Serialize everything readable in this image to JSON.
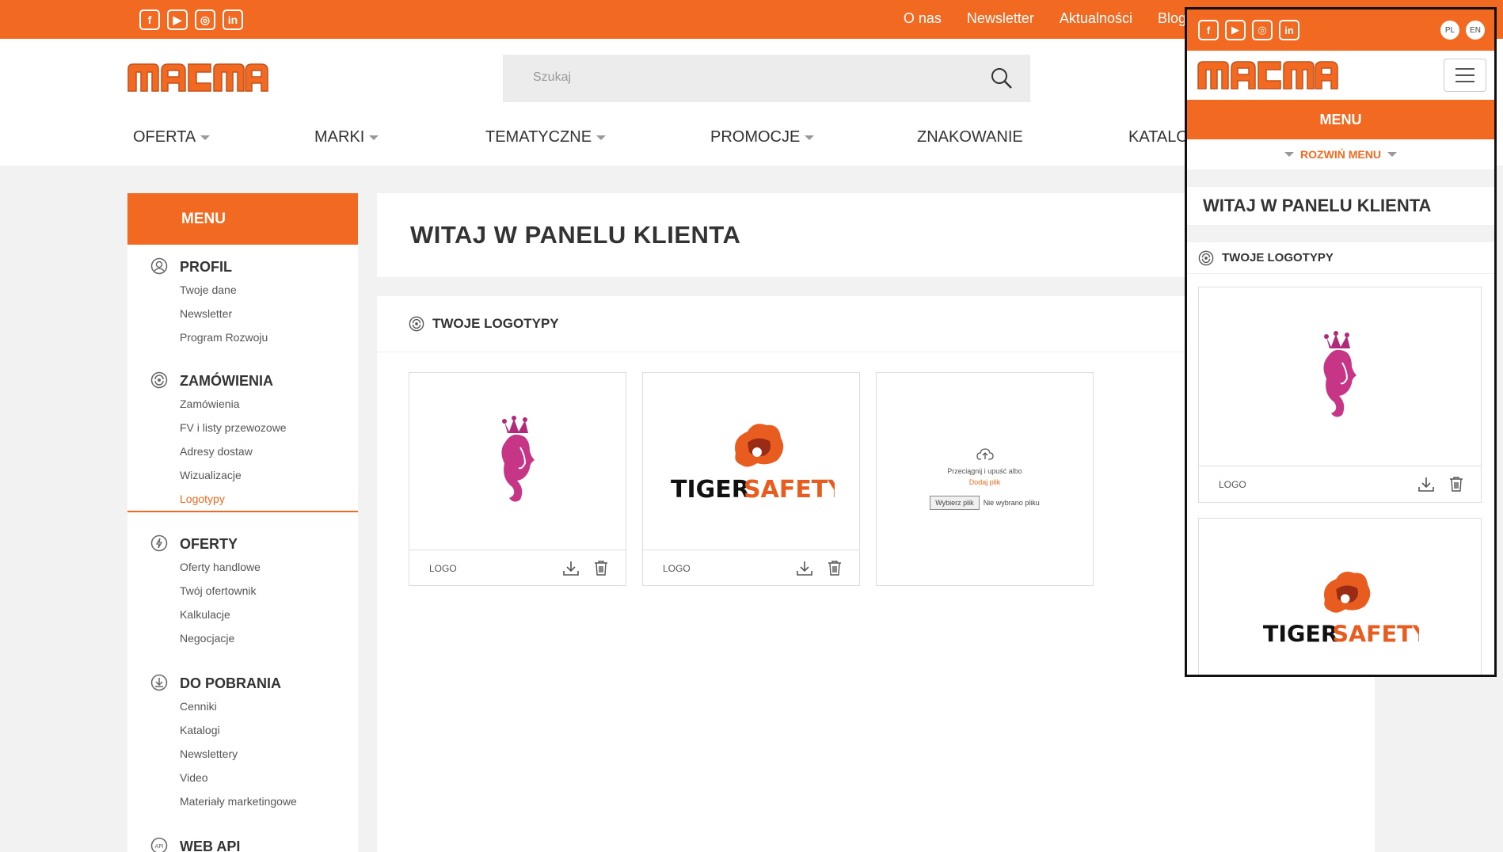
{
  "brand": {
    "logo_text": "MACMA",
    "accent": "#f26a21"
  },
  "topbar": {
    "social_icons": [
      "facebook-icon",
      "youtube-icon",
      "instagram-icon",
      "linkedin-icon"
    ],
    "links": [
      "O nas",
      "Newsletter",
      "Aktualności",
      "Blog"
    ]
  },
  "search": {
    "placeholder": "Szukaj"
  },
  "nav": [
    {
      "label": "OFERTA",
      "dropdown": true
    },
    {
      "label": "MARKI",
      "dropdown": true
    },
    {
      "label": "TEMATYCZNE",
      "dropdown": true
    },
    {
      "label": "PROMOCJE",
      "dropdown": true
    },
    {
      "label": "ZNAKOWANIE",
      "dropdown": false
    },
    {
      "label": "KATALO",
      "dropdown": false
    }
  ],
  "sidebar": {
    "title": "MENU",
    "sections": [
      {
        "title": "PROFIL",
        "icon": "user-icon",
        "items": [
          "Twoje dane",
          "Newsletter",
          "Program Rozwoju"
        ]
      },
      {
        "title": "ZAMÓWIENIA",
        "icon": "orders-icon",
        "items": [
          "Zamówienia",
          "FV i listy przewozowe",
          "Adresy dostaw",
          "Wizualizacje",
          "Logotypy"
        ],
        "active": "Logotypy"
      },
      {
        "title": "OFERTY",
        "icon": "offers-icon",
        "items": [
          "Oferty handlowe",
          "Twój ofertownik",
          "Kalkulacje",
          "Negocjacje"
        ]
      },
      {
        "title": "DO POBRANIA",
        "icon": "download-circle-icon",
        "items": [
          "Cenniki",
          "Katalogi",
          "Newslettery",
          "Video",
          "Materiały marketingowe"
        ]
      },
      {
        "title": "WEB API",
        "icon": "api-icon",
        "items": []
      }
    ]
  },
  "main": {
    "welcome_title": "WITAJ W PANELU KLIENTA",
    "logos_title": "TWOJE LOGOTYPY",
    "cards": [
      {
        "label": "LOGO",
        "image": "queen-logo"
      },
      {
        "label": "LOGO",
        "image": "tigersafety-logo"
      }
    ],
    "upload": {
      "text": "Przeciągnij i upuść albo",
      "link": "Dodaj plik",
      "button": "Wybierz plik",
      "status": "Nie wybrano pliku"
    }
  },
  "mobile": {
    "langs": [
      "PL",
      "EN"
    ],
    "menu": "MENU",
    "expand": "ROZWIŃ MENU",
    "welcome_title": "WITAJ W PANELU KLIENTA",
    "logos_title": "TWOJE LOGOTYPY",
    "card_label": "LOGO"
  },
  "tigersafety": {
    "part1": "TIGER",
    "part2": "SAFETY"
  }
}
